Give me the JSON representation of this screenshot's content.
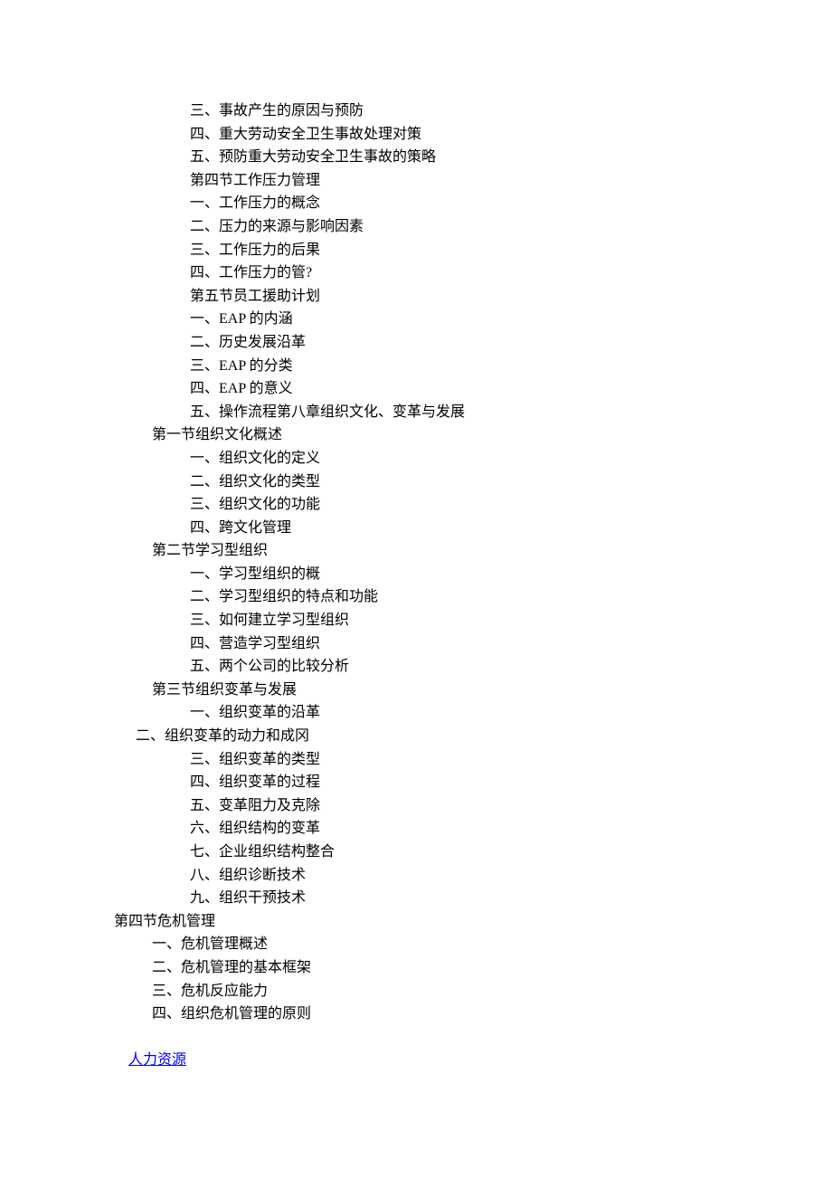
{
  "lines": [
    {
      "cls": "indent-1",
      "text": "三、事故产生的原因与预防"
    },
    {
      "cls": "indent-1",
      "text": "四、重大劳动安全卫生事故处理对策"
    },
    {
      "cls": "indent-1",
      "text": "五、预防重大劳动安全卫生事故的策略"
    },
    {
      "cls": "indent-1",
      "text": "第四节工作压力管理"
    },
    {
      "cls": "indent-1",
      "text": "一、工作压力的概念"
    },
    {
      "cls": "indent-1",
      "text": "二、压力的来源与影响因素"
    },
    {
      "cls": "indent-1",
      "text": "三、工作压力的后果"
    },
    {
      "cls": "indent-1",
      "text": "四、工作压力的管?"
    },
    {
      "cls": "indent-1",
      "text": "第五节员工援助计划"
    },
    {
      "cls": "indent-1",
      "text": "一、EAP 的内涵"
    },
    {
      "cls": "indent-1",
      "text": "二、历史发展沿革"
    },
    {
      "cls": "indent-1",
      "text": "三、EAP 的分类"
    },
    {
      "cls": "indent-1",
      "text": "四、EAP 的意义"
    },
    {
      "cls": "indent-1",
      "text": "五、操作流程第八章组织文化、变革与发展"
    },
    {
      "cls": "indent-2",
      "text": "第一节组织文化概述"
    },
    {
      "cls": "indent-1",
      "text": "一、组织文化的定义"
    },
    {
      "cls": "indent-1",
      "text": "二、组织文化的类型"
    },
    {
      "cls": "indent-1",
      "text": "三、组织文化的功能"
    },
    {
      "cls": "indent-1",
      "text": "四、跨文化管理"
    },
    {
      "cls": "indent-2",
      "text": "第二节学习型组织"
    },
    {
      "cls": "indent-1",
      "text": "一、学习型组织的概"
    },
    {
      "cls": "indent-1",
      "text": "二、学习型组织的特点和功能"
    },
    {
      "cls": "indent-1",
      "text": "三、如何建立学习型组织"
    },
    {
      "cls": "indent-1",
      "text": "四、营造学习型组织"
    },
    {
      "cls": "indent-1",
      "text": "五、两个公司的比较分析"
    },
    {
      "cls": "indent-2",
      "text": "第三节组织变革与发展"
    },
    {
      "cls": "indent-1",
      "text": "一、组织变革的沿革"
    },
    {
      "cls": "indent-4",
      "text": "二、组织变革的动力和成冈"
    },
    {
      "cls": "indent-1",
      "text": "三、组织变革的类型"
    },
    {
      "cls": "indent-1",
      "text": "四、组织变革的过程"
    },
    {
      "cls": "indent-1",
      "text": "五、变革阻力及克除"
    },
    {
      "cls": "indent-1",
      "text": "六、组织结构的变革"
    },
    {
      "cls": "indent-1",
      "text": "七、企业组织结构整合"
    },
    {
      "cls": "indent-1",
      "text": "八、组织诊断技术"
    },
    {
      "cls": "indent-1",
      "text": "九、组织干预技术"
    },
    {
      "cls": "indent-3",
      "text": "第四节危机管理"
    },
    {
      "cls": "indent-2",
      "text": "一、危机管理概述"
    },
    {
      "cls": "indent-2",
      "text": "二、危机管理的基本框架"
    },
    {
      "cls": "indent-2",
      "text": "三、危机反应能力"
    },
    {
      "cls": "indent-2",
      "text": "四、组织危机管理的原则"
    }
  ],
  "link_text": "人力资源"
}
